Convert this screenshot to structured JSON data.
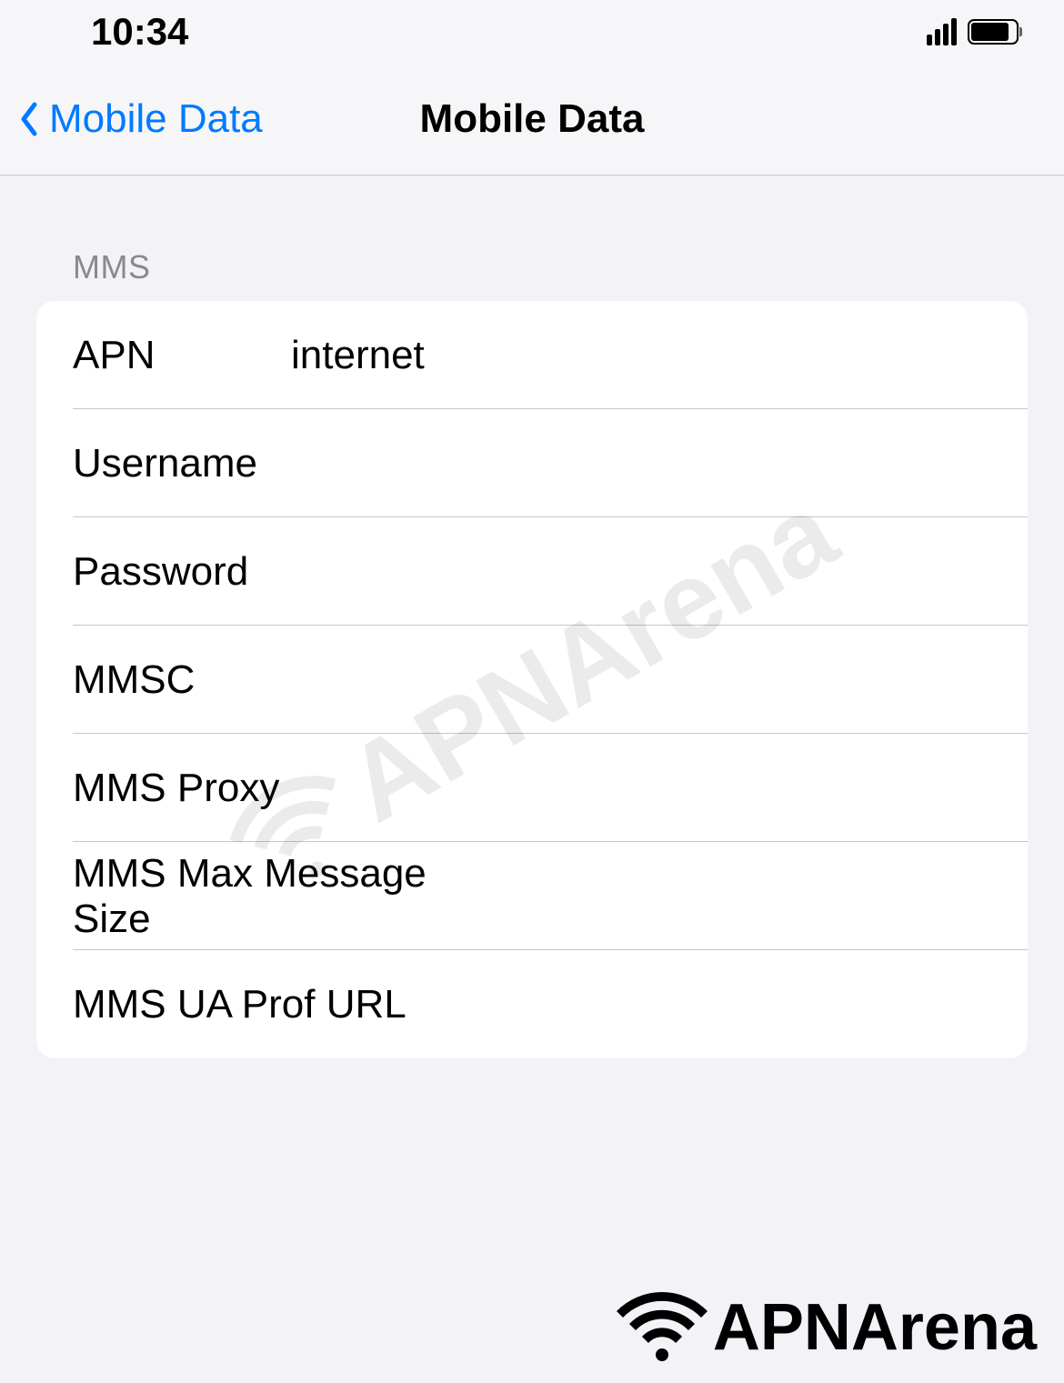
{
  "statusBar": {
    "time": "10:34"
  },
  "navHeader": {
    "backLabel": "Mobile Data",
    "title": "Mobile Data"
  },
  "section": {
    "header": "MMS",
    "rows": [
      {
        "label": "APN",
        "value": "internet"
      },
      {
        "label": "Username",
        "value": ""
      },
      {
        "label": "Password",
        "value": ""
      },
      {
        "label": "MMSC",
        "value": ""
      },
      {
        "label": "MMS Proxy",
        "value": ""
      },
      {
        "label": "MMS Max Message Size",
        "value": ""
      },
      {
        "label": "MMS UA Prof URL",
        "value": ""
      }
    ]
  },
  "watermark": {
    "text": "APNArena"
  },
  "footerBrand": {
    "text": "APNArena"
  }
}
